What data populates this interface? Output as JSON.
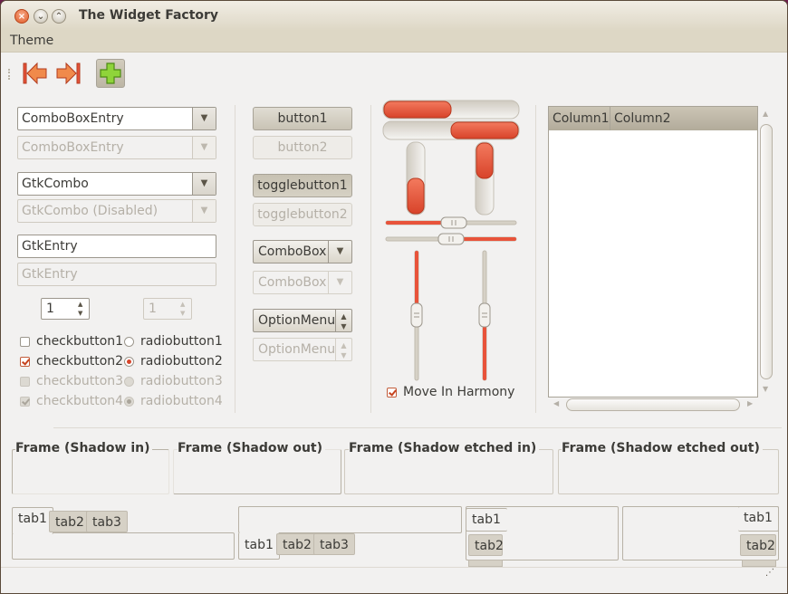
{
  "window": {
    "title": "The Widget Factory"
  },
  "menu": {
    "items": [
      "Theme"
    ]
  },
  "left": {
    "combo_entry": "ComboBoxEntry",
    "combo_entry_disabled": "ComboBoxEntry",
    "gtkcombo": "GtkCombo",
    "gtkcombo_disabled": "GtkCombo (Disabled)",
    "entry": "GtkEntry",
    "entry_disabled": "GtkEntry",
    "spin": "1",
    "spin_disabled": "1",
    "check1": "checkbutton1",
    "check2": "checkbutton2",
    "check3": "checkbutton3",
    "check4": "checkbutton4",
    "radio1": "radiobutton1",
    "radio2": "radiobutton2",
    "radio3": "radiobutton3",
    "radio4": "radiobutton4"
  },
  "middle": {
    "button1": "button1",
    "button2": "button2",
    "toggle1": "togglebutton1",
    "toggle2": "togglebutton2",
    "combobox": "ComboBox",
    "combobox_disabled": "ComboBox",
    "optionmenu": "OptionMenu",
    "optionmenu_disabled": "OptionMenu"
  },
  "sliders": {
    "hprogress1": 0.5,
    "hprogress2": 0.5,
    "vprogress1": 0.5,
    "vprogress2": 0.5,
    "hscale1": 0.5,
    "hscale2": 0.5,
    "vscale1": 0.5,
    "vscale2": 0.5,
    "move_in_harmony": "Move In Harmony"
  },
  "tree": {
    "columns": [
      "Column1",
      "Column2"
    ]
  },
  "frames": [
    "Frame (Shadow in)",
    "Frame (Shadow out)",
    "Frame (Shadow etched in)",
    "Frame (Shadow etched out)"
  ],
  "notebooks": {
    "tabs": [
      "tab1",
      "tab2",
      "tab3"
    ]
  },
  "colors": {
    "accent": "#e8533a",
    "titlebar": "#ddd7c5",
    "window_bg": "#f2f1f0"
  }
}
